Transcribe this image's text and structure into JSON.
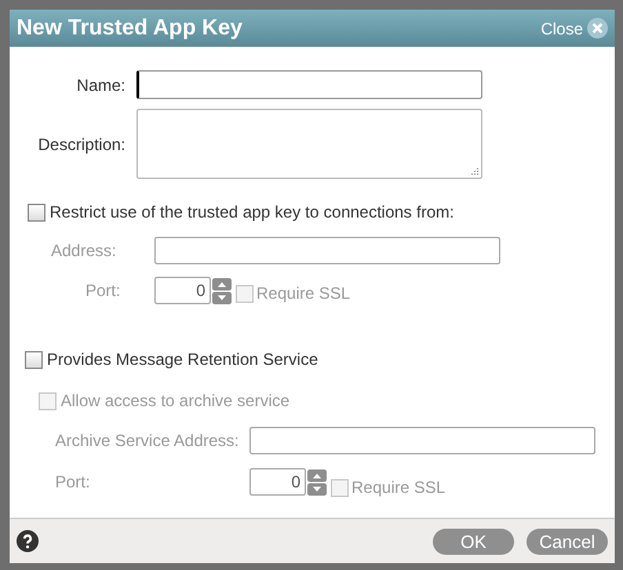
{
  "dialog": {
    "title": "New Trusted App Key",
    "close_label": "Close"
  },
  "name": {
    "label": "Name:",
    "focused": true
  },
  "description": {
    "label": "Description:"
  },
  "restrict": {
    "label": "Restrict use of the trusted app key to connections from:",
    "checked": false,
    "address": {
      "label": "Address:",
      "disabled": true
    },
    "port": {
      "label": "Port:",
      "value": "0",
      "disabled": true
    },
    "require_ssl": {
      "label": "Require SSL",
      "checked": false,
      "disabled": true
    }
  },
  "retention": {
    "label": "Provides Message Retention Service",
    "checked": false,
    "allow_access": {
      "label": "Allow access to archive service",
      "checked": false,
      "disabled": true
    },
    "address": {
      "label": "Archive Service Address:",
      "disabled": true
    },
    "port": {
      "label": "Port:",
      "value": "0",
      "disabled": true
    },
    "require_ssl": {
      "label": "Require SSL",
      "checked": false,
      "disabled": true
    }
  },
  "buttons": [
    {
      "label": "OK"
    },
    {
      "label": "Cancel"
    }
  ]
}
